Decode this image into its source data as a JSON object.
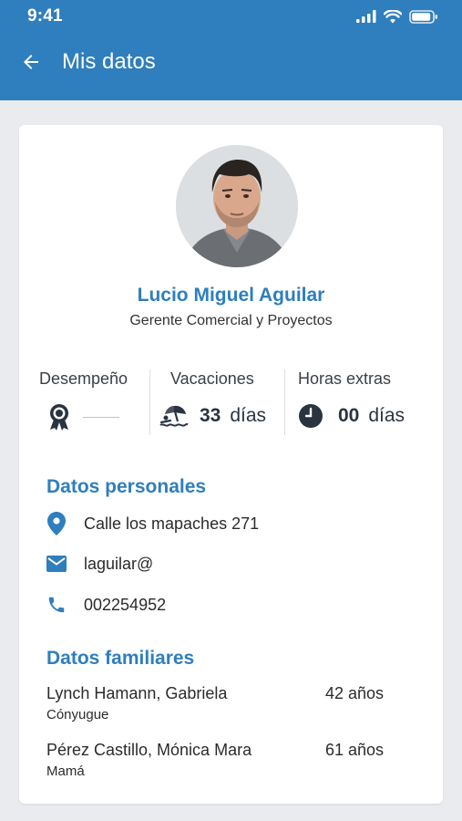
{
  "status_bar": {
    "time": "9:41"
  },
  "app_bar": {
    "title": "Mis datos"
  },
  "profile": {
    "name": "Lucio Miguel Aguilar",
    "role": "Gerente Comercial y Proyectos"
  },
  "stats": {
    "performance": {
      "label": "Desempeño"
    },
    "vacation": {
      "label": "Vacaciones",
      "number": "33",
      "unit": "días"
    },
    "overtime": {
      "label": "Horas extras",
      "number": "00",
      "unit": "días"
    }
  },
  "personal": {
    "title": "Datos personales",
    "address": "Calle los mapaches 271",
    "email": "laguilar@",
    "phone": "002254952"
  },
  "family": {
    "title": "Datos familiares",
    "members": [
      {
        "name": "Lynch Hamann, Gabriela",
        "relation": "Cónyugue",
        "age": "42 años"
      },
      {
        "name": "Pérez Castillo, Mónica Mara",
        "relation": "Mamá",
        "age": "61 años"
      }
    ]
  },
  "colors": {
    "brand": "#2f7ebd",
    "background": "#e9ebee",
    "dark_icon": "#2a3340"
  },
  "icons": [
    "back-arrow-icon",
    "signal-icon",
    "wifi-icon",
    "battery-icon",
    "medal-icon",
    "beach-icon",
    "clock-icon",
    "location-pin-icon",
    "mail-icon",
    "phone-icon"
  ]
}
